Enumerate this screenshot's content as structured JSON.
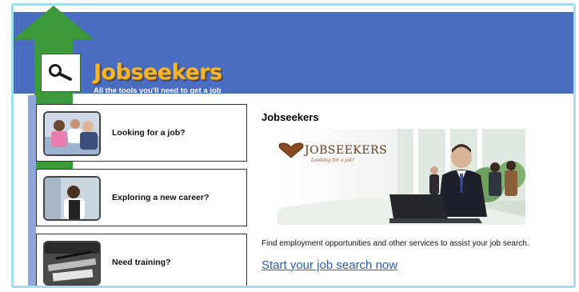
{
  "header": {
    "title": "Jobseekers",
    "tagline": "All the tools you'll need to get a job"
  },
  "menu": {
    "items": [
      {
        "label": "Looking for a job?"
      },
      {
        "label": "Exploring a new career?"
      },
      {
        "label": "Need training?"
      }
    ]
  },
  "main": {
    "title": "Jobseekers",
    "banner_logo": "JOBSEEKERS",
    "banner_sub": "Looking for a job!",
    "description": "Find employment opportunities and other services to assist your job search.",
    "cta_link": "Start your job search now"
  },
  "colors": {
    "header_blue": "#4a6dc0",
    "arrow_green": "#3d9a3a",
    "logo_gold": "#f4b52a",
    "link_blue": "#2a5db0",
    "frame_cyan": "#9fe0ea"
  },
  "icons": {
    "header_icon": "magnifier-icon"
  }
}
